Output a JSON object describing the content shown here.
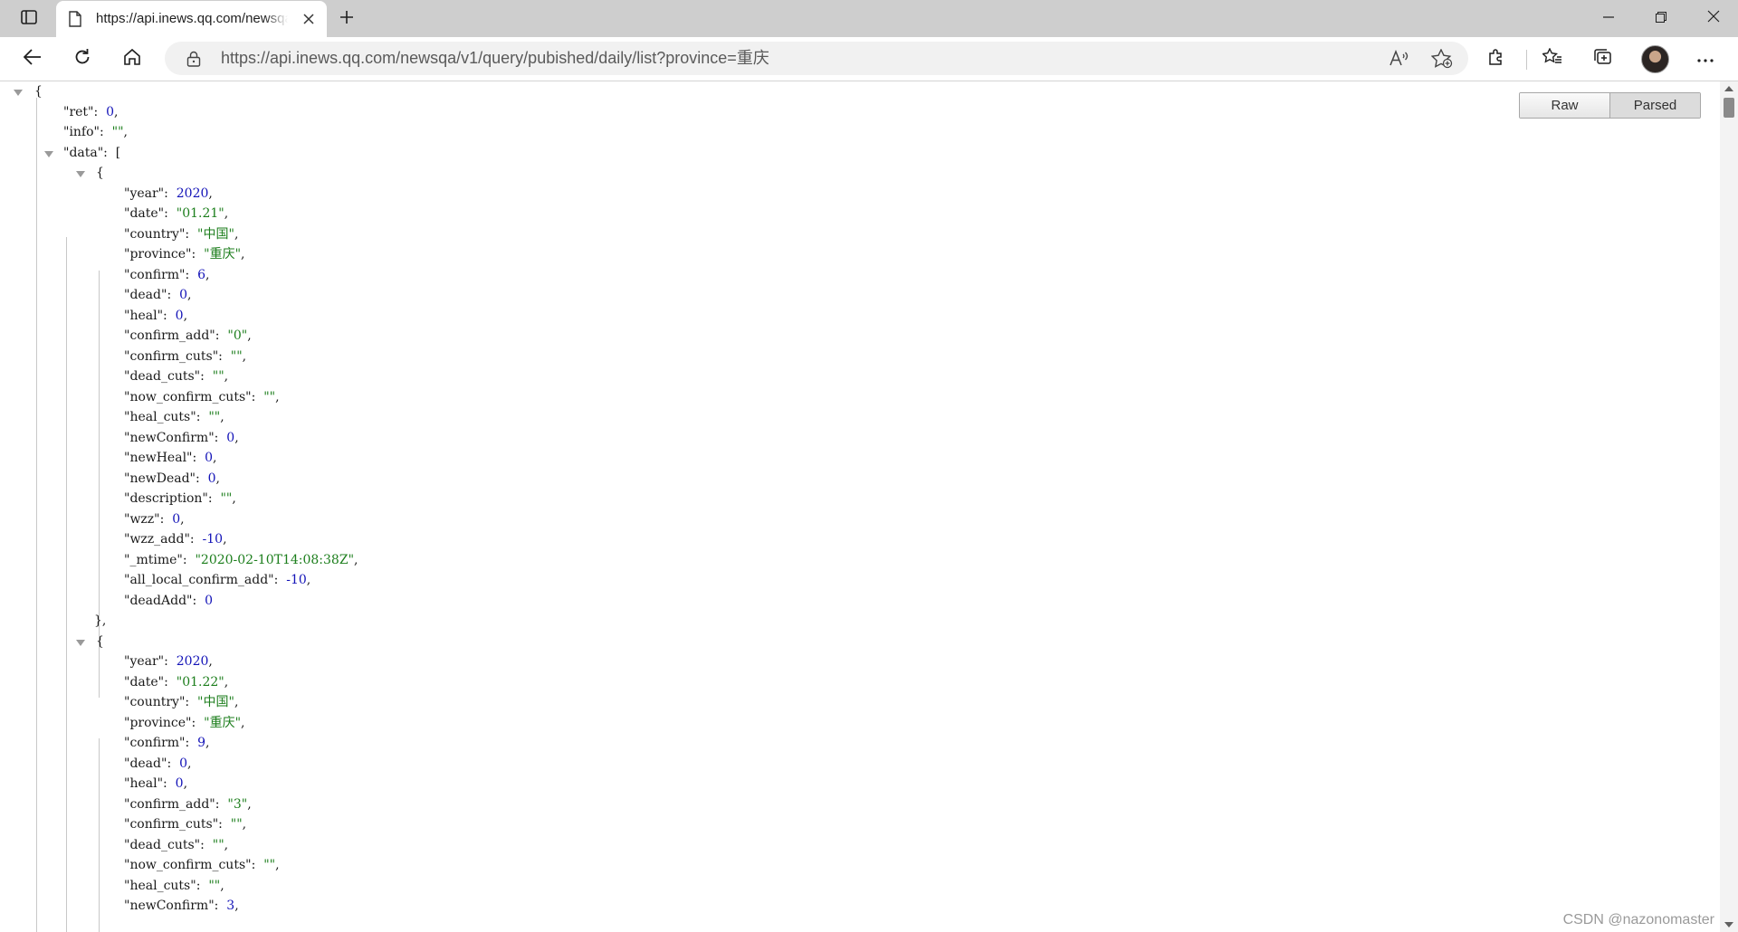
{
  "tab": {
    "title": "https://api.inews.qq.com/newsqa/v1/query/pubished/daily/list?province=重庆"
  },
  "address": {
    "url": "https://api.inews.qq.com/newsqa/v1/query/pubished/daily/list?province=重庆"
  },
  "view_toggle": {
    "raw": "Raw",
    "parsed": "Parsed",
    "active": "Parsed"
  },
  "watermark": "CSDN @nazonomaster",
  "json": {
    "ret": 0,
    "info": "",
    "data": [
      {
        "year": 2020,
        "date": "01.21",
        "country": "中国",
        "province": "重庆",
        "confirm": 6,
        "dead": 0,
        "heal": 0,
        "confirm_add": "0",
        "confirm_cuts": "",
        "dead_cuts": "",
        "now_confirm_cuts": "",
        "heal_cuts": "",
        "newConfirm": 0,
        "newHeal": 0,
        "newDead": 0,
        "description": "",
        "wzz": 0,
        "wzz_add": -10,
        "_mtime": "2020-02-10T14:08:38Z",
        "all_local_confirm_add": -10,
        "deadAdd": 0
      },
      {
        "year": 2020,
        "date": "01.22",
        "country": "中国",
        "province": "重庆",
        "confirm": 9,
        "dead": 0,
        "heal": 0,
        "confirm_add": "3",
        "confirm_cuts": "",
        "dead_cuts": "",
        "now_confirm_cuts": "",
        "heal_cuts": "",
        "newConfirm": 3
      }
    ]
  }
}
